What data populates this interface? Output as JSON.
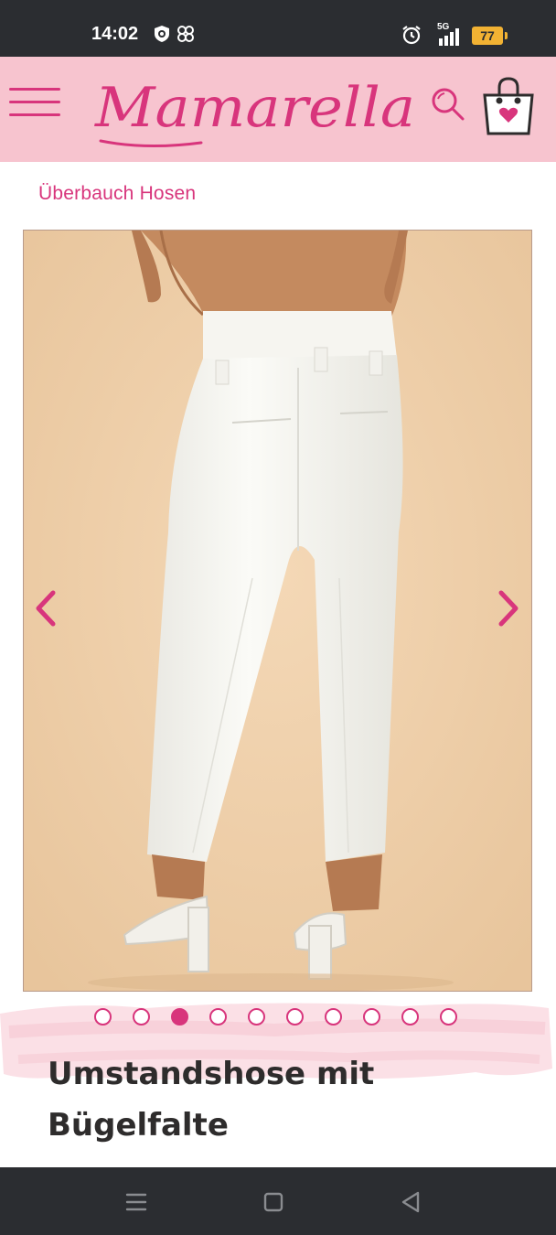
{
  "status_bar": {
    "time": "14:02",
    "network": "5G",
    "battery": "77",
    "icons": [
      "vpn-shield-icon",
      "pinwheel-icon",
      "alarm-icon",
      "signal-icon",
      "battery-icon"
    ]
  },
  "header": {
    "logo_text": "Mamarella",
    "menu_icon": "hamburger-menu-icon",
    "search_icon": "search-icon",
    "cart_icon": "shopping-bag-heart-icon"
  },
  "breadcrumb": {
    "label": "Überbauch Hosen"
  },
  "gallery": {
    "image_alt": "Umstandshose mit Bügelfalte",
    "prev_icon": "chevron-left-icon",
    "next_icon": "chevron-right-icon",
    "slide_count": 10,
    "active_slide": 3
  },
  "product": {
    "title_line1": "Umstandshose mit",
    "title_line2": "Bügelfalte"
  },
  "nav_bar": {
    "icons": [
      "recent-apps-icon",
      "home-icon",
      "back-icon"
    ]
  },
  "colors": {
    "brand_pink": "#d8357c",
    "header_bg": "#f7c4cf",
    "system_bar": "#2b2d31",
    "title_text": "#2e2c2c"
  }
}
